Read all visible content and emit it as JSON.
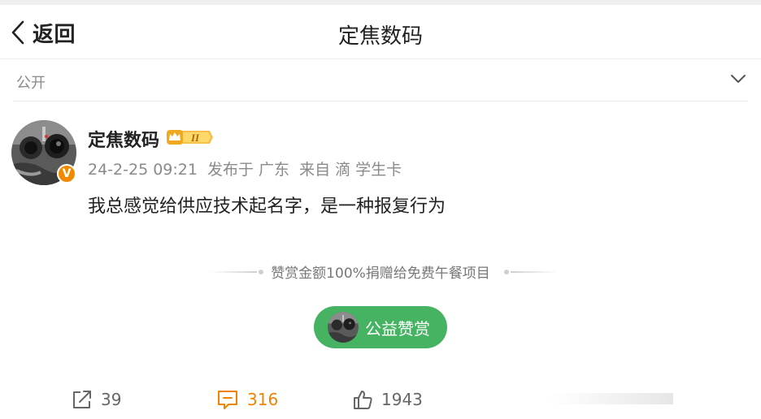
{
  "header": {
    "back_label": "返回",
    "title": "定焦数码"
  },
  "visibility": {
    "label": "公开"
  },
  "post": {
    "author": "定焦数码",
    "verified_badge": "V",
    "level_badge": "II",
    "date": "24-2-25 09:21",
    "location": "发布于 广东",
    "source": "来自 滴 学生卡",
    "content": "我总感觉给供应技术起名字，是一种报复行为"
  },
  "reward": {
    "note": "赞赏金额100%捐赠给免费午餐项目",
    "button_label": "公益赞赏"
  },
  "actions": {
    "share_count": "39",
    "comment_count": "316",
    "like_count": "1943"
  },
  "colors": {
    "comment_accent": "#f08300",
    "reward_green": "#45b362",
    "verified_orange": "#f28a00"
  }
}
